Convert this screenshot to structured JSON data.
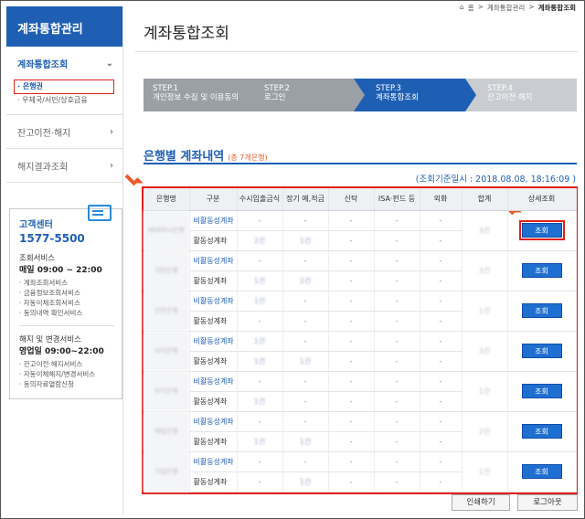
{
  "sidebar": {
    "title": "계좌통합관리",
    "menus": [
      {
        "label": "계좌통합조회",
        "chev": "⌄",
        "subs": [
          "은행권",
          "우체국/서민/상호금융"
        ]
      },
      {
        "label": "잔고이전·해지",
        "chev": "›"
      },
      {
        "label": "해지결과조회",
        "chev": "›"
      }
    ],
    "cs": {
      "title": "고객센터",
      "phone": "1577-5500",
      "s1_title": "조회서비스",
      "s1_hours": "매일 09:00 ~ 22:00",
      "s1_items": [
        "· 계좌조회서비스",
        "· 금융정보조회서비스",
        "· 자동이체조회서비스",
        "· 동의내역 확인서비스"
      ],
      "s2_title": "해지 및 변경서비스",
      "s2_hours": "영업일 09:00~22:00",
      "s2_items": [
        "· 잔고이전·해지서비스",
        "· 자동이체해지/변경서비스",
        "· 동의자료열람신청"
      ]
    }
  },
  "breadcrumb": {
    "home": "홈",
    "sep": ">",
    "mid": "계좌통합관리",
    "current": "계좌통합조회"
  },
  "page_title": "계좌통합조회",
  "steps": [
    {
      "num": "STEP.1",
      "label": "개인정보 수집 및 이용동의"
    },
    {
      "num": "STEP.2",
      "label": "로그인"
    },
    {
      "num": "STEP.3",
      "label": "계좌통합조회"
    },
    {
      "num": "STEP.4",
      "label": "잔고이전·해지"
    }
  ],
  "section": {
    "title": "은행별 계좌내역",
    "count": "(총 7개은행)"
  },
  "ref_date": "(조회기준일시 : 2018.08.08, 18:16:09 )",
  "table": {
    "headers": [
      "은행명",
      "구분",
      "수시입출금식",
      "정기 예,적금",
      "신탁",
      "ISA·펀드 등",
      "외화",
      "합계",
      "상세조회"
    ],
    "type_inactive": "비활동성계좌",
    "type_active": "활동성계좌",
    "dash": "-",
    "view_label": "조회",
    "banks": [
      {
        "name": "KEB하나은행",
        "inactive": [
          "-",
          "-",
          "-",
          "-",
          "-"
        ],
        "active": [
          "2건",
          "1건",
          "-",
          "-",
          "-"
        ],
        "sum": "3건"
      },
      {
        "name": "국민은행",
        "inactive": [
          "-",
          "-",
          "-",
          "-",
          "-"
        ],
        "active": [
          "1건",
          "2건",
          "-",
          "-",
          "-"
        ],
        "sum": "3건"
      },
      {
        "name": "신한은행",
        "inactive": [
          "1건",
          "-",
          "-",
          "-",
          "-"
        ],
        "active": [
          "-",
          "-",
          "-",
          "-",
          "-"
        ],
        "sum": "1건"
      },
      {
        "name": "씨티은행",
        "inactive": [
          "1건",
          "-",
          "-",
          "-",
          "-"
        ],
        "active": [
          "1건",
          "1건",
          "-",
          "-",
          "-"
        ],
        "sum": "3건"
      },
      {
        "name": "우리은행",
        "inactive": [
          "-",
          "-",
          "-",
          "-",
          "-"
        ],
        "active": [
          "1건",
          "-",
          "-",
          "-",
          "-"
        ],
        "sum": "1건"
      },
      {
        "name": "제일은행",
        "inactive": [
          "-",
          "-",
          "-",
          "-",
          "-"
        ],
        "active": [
          "1건",
          "1건",
          "-",
          "-",
          "-"
        ],
        "sum": "2건"
      },
      {
        "name": "기업은행",
        "inactive": [
          "-",
          "-",
          "-",
          "-",
          "-"
        ],
        "active": [
          "-",
          "1건",
          "-",
          "-",
          "-"
        ],
        "sum": "1건"
      }
    ]
  },
  "buttons": {
    "print": "인쇄하기",
    "logout": "로그아웃"
  }
}
